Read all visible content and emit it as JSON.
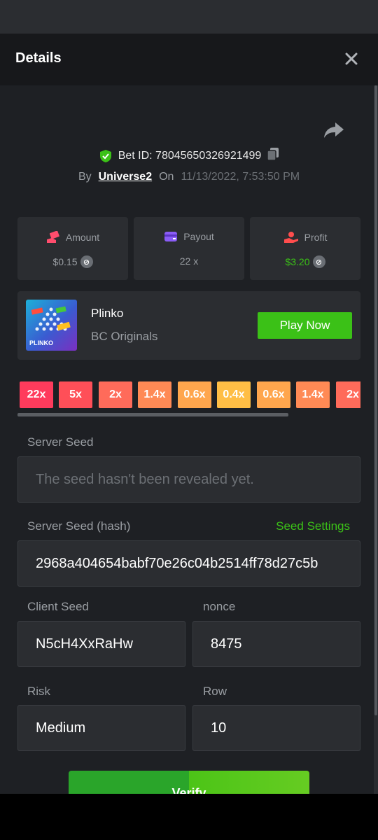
{
  "header": {
    "title": "Details"
  },
  "bet": {
    "id_text": "Bet ID: 78045650326921499",
    "by_label": "By",
    "user": "Universe2",
    "on_label": "On",
    "date": "11/13/2022, 7:53:50 PM"
  },
  "stats": [
    {
      "label": "Amount",
      "value": "$0.15",
      "color": "#9a9ea3",
      "icon": "money-hand-icon"
    },
    {
      "label": "Payout",
      "value": "22 x",
      "color": "#9a9ea3",
      "icon": "wallet-icon"
    },
    {
      "label": "Profit",
      "value": "$3.20",
      "color": "#3bc117",
      "icon": "profit-hand-icon"
    }
  ],
  "game": {
    "name": "Plinko",
    "provider": "BC Originals",
    "thumb_label": "PLINKO",
    "play_label": "Play Now"
  },
  "multipliers": [
    {
      "label": "22x",
      "color": "#ff3b5c"
    },
    {
      "label": "5x",
      "color": "#ff4f58"
    },
    {
      "label": "2x",
      "color": "#ff6b5a"
    },
    {
      "label": "1.4x",
      "color": "#ff8a55"
    },
    {
      "label": "0.6x",
      "color": "#ffa64d"
    },
    {
      "label": "0.4x",
      "color": "#ffbe45"
    },
    {
      "label": "0.6x",
      "color": "#ffa64d"
    },
    {
      "label": "1.4x",
      "color": "#ff8a55"
    },
    {
      "label": "2x",
      "color": "#ff6b5a"
    }
  ],
  "fields": {
    "server_seed_label": "Server Seed",
    "server_seed_placeholder": "The seed hasn't been revealed yet.",
    "hash_label": "Server Seed (hash)",
    "seed_settings": "Seed Settings",
    "hash_value": "2968a404654babf70e26c04b2514ff78d27c5b",
    "client_seed_label": "Client Seed",
    "client_seed_value": "N5cH4XxRaHw",
    "nonce_label": "nonce",
    "nonce_value": "8475",
    "risk_label": "Risk",
    "risk_value": "Medium",
    "row_label": "Row",
    "row_value": "10"
  },
  "verify_label": "Verify",
  "accent": "#3bc117"
}
